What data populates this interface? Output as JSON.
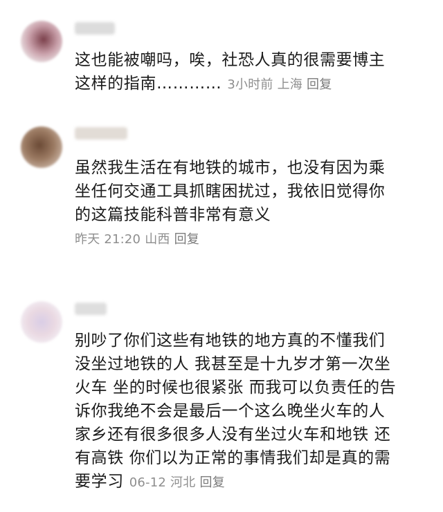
{
  "comments": [
    {
      "username": "昵称",
      "text_lines": [
        "这也能被嘲吗，唉，社恐人真的很需要博主",
        "这样的指南…………"
      ],
      "time": "3小时前",
      "location": "上海",
      "reply_label": "回复"
    },
    {
      "username": "昵称",
      "text_lines": [
        "虽然我生活在有地铁的城市，也没有因为乘",
        "坐任何交通工具抓瞎困扰过，我依旧觉得你",
        "的这篇技能科普非常有意义"
      ],
      "time": "昨天 21:20",
      "location": "山西",
      "reply_label": "回复"
    },
    {
      "username": "昵称",
      "text_lines": [
        "别吵了你们这些有地铁的地方真的不懂我们",
        "没坐过地铁的人 我甚至是十九岁才第一次坐",
        "火车 坐的时候也很紧张 而我可以负责任的告",
        "诉你我绝不会是最后一个这么晚坐火车的人",
        "家乡还有很多很多人没有坐过火车和地铁 还",
        "有高铁 你们以为正常的事情我们却是真的需",
        "要学习"
      ],
      "time": "06-12",
      "location": "河北",
      "reply_label": "回复"
    }
  ]
}
